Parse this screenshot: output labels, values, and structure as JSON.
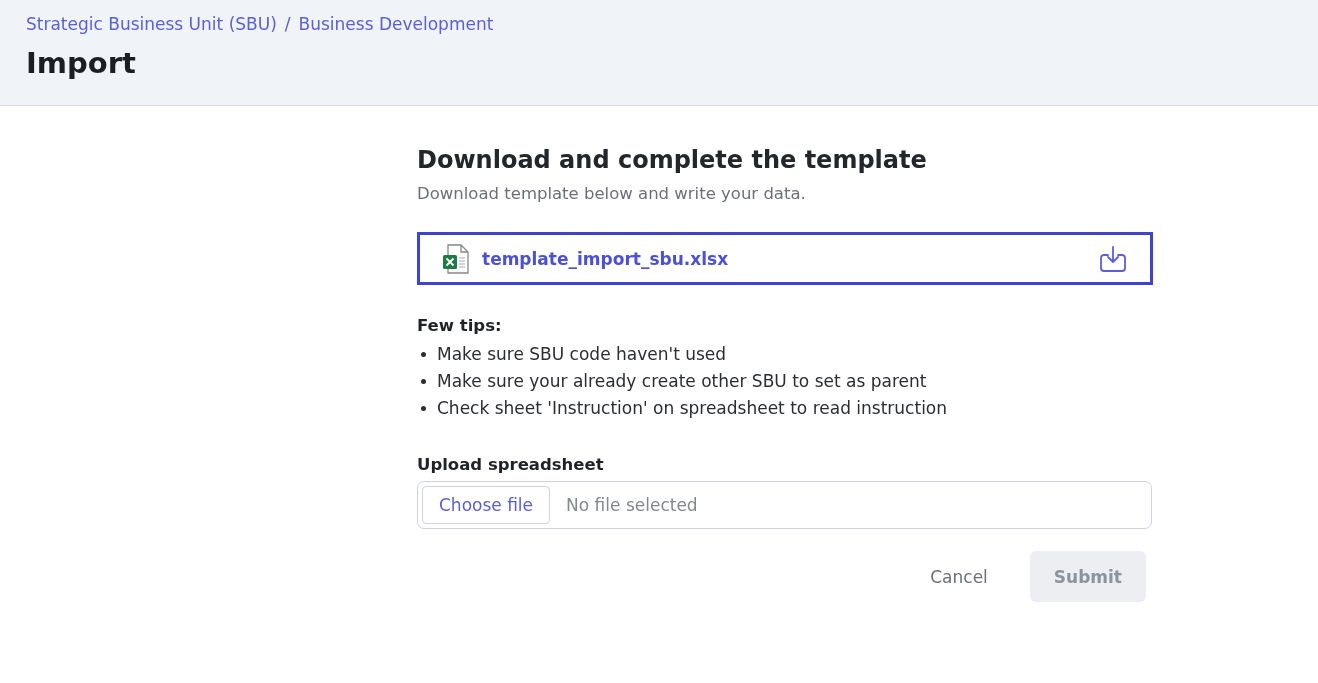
{
  "breadcrumbs": [
    {
      "label": "Strategic Business Unit (SBU)"
    },
    {
      "label": "Business Development"
    }
  ],
  "breadcrumb_separator": "/",
  "page_title": "Import",
  "section": {
    "title": "Download and complete the template",
    "subtitle": "Download template below and write your data."
  },
  "template_file": {
    "name": "template_import_sbu.xlsx",
    "focused": true
  },
  "tips": {
    "title": "Few tips:",
    "items": [
      "Make sure SBU code haven't used",
      "Make sure your already create other SBU to set as parent",
      "Check sheet 'Instruction' on spreadsheet to read instruction"
    ]
  },
  "upload": {
    "label": "Upload spreadsheet",
    "button": "Choose file",
    "status": "No file selected"
  },
  "buttons": [
    {
      "label": "Cancel",
      "kind": "text",
      "disabled": false
    },
    {
      "label": "Submit",
      "kind": "primary",
      "disabled": true
    }
  ]
}
